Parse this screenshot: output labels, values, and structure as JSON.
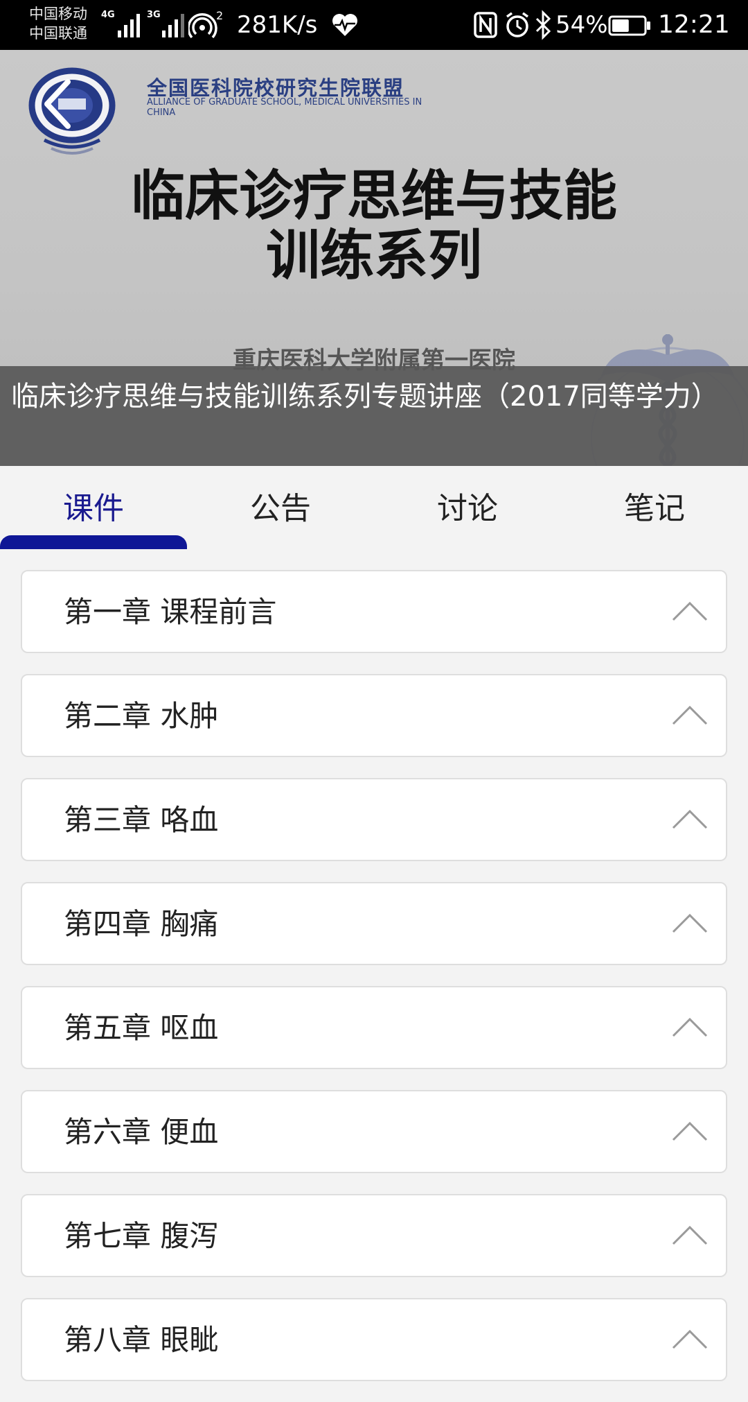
{
  "status_bar": {
    "carrier_1": "中国移动",
    "carrier_2": "中国联通",
    "network_1": "4G",
    "network_2": "3G",
    "hotspot_count": "2",
    "net_speed": "281K/s",
    "battery_percent": "54%",
    "battery_level": 0.54,
    "time": "12:21",
    "icons": [
      "signal-icon",
      "hotspot-icon",
      "heart-rate-icon",
      "nfc-icon",
      "alarm-icon",
      "bluetooth-icon",
      "battery-icon"
    ]
  },
  "banner": {
    "alliance_name_cn": "全国医科院校研究生院联盟",
    "alliance_name_en": "ALLIANCE OF GRADUATE SCHOOL, MEDICAL UNIVERSITIES IN CHINA",
    "title_line1": "临床诊疗思维与技能",
    "title_line2": "训练系列",
    "hospital": "重庆医科大学附属第一医院",
    "caption": "临床诊疗思维与技能训练系列专题讲座（2017同等学力）"
  },
  "tabs": [
    {
      "label": "课件",
      "active": true
    },
    {
      "label": "公告",
      "active": false
    },
    {
      "label": "讨论",
      "active": false
    },
    {
      "label": "笔记",
      "active": false
    }
  ],
  "chapters": [
    {
      "label": "第一章 课程前言"
    },
    {
      "label": "第二章 水肿"
    },
    {
      "label": "第三章 咯血"
    },
    {
      "label": "第四章 胸痛"
    },
    {
      "label": "第五章 呕血"
    },
    {
      "label": "第六章 便血"
    },
    {
      "label": "第七章 腹泻"
    },
    {
      "label": "第八章 眼眦"
    }
  ],
  "colors": {
    "accent": "#0f1796",
    "active_tab_text": "#1a1a8f",
    "caption_bg": "#585858",
    "page_bg": "#f3f3f3"
  }
}
